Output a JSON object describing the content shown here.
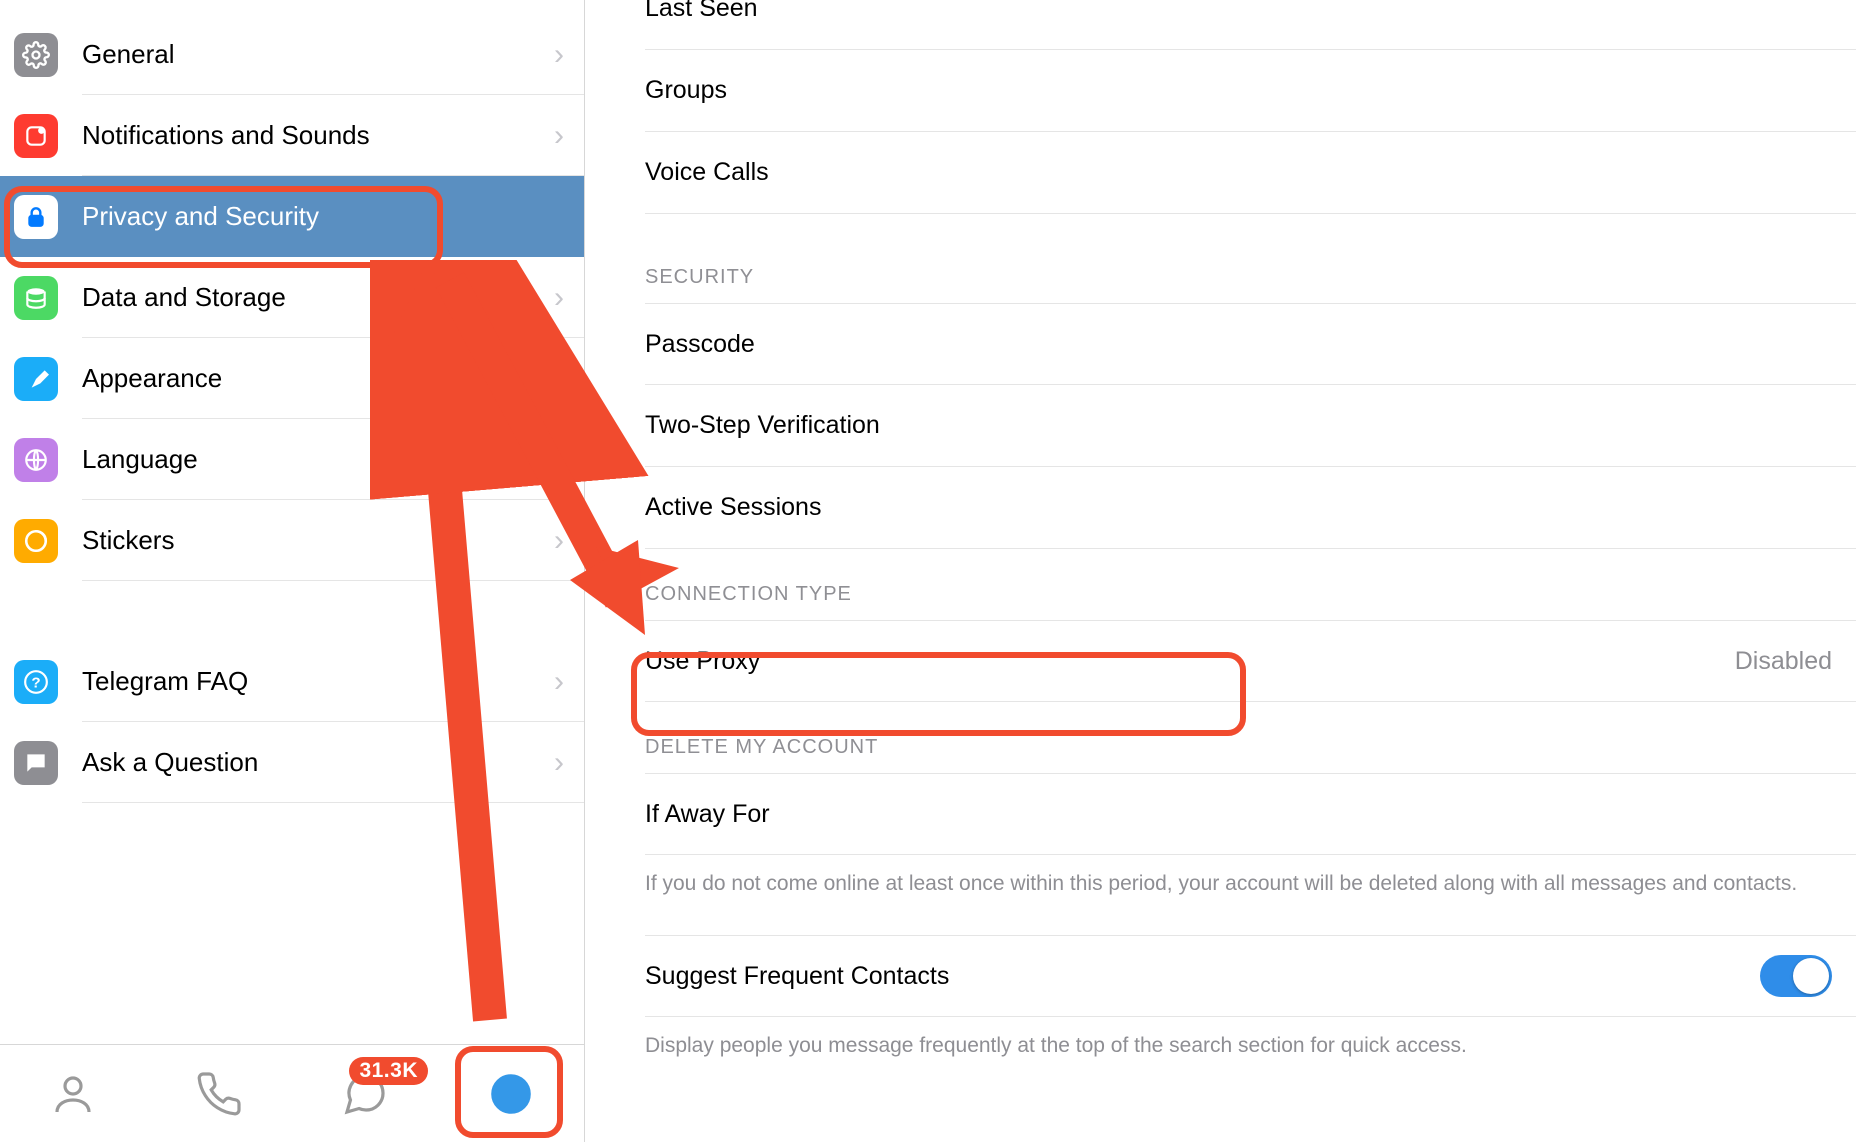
{
  "sidebar": {
    "items": [
      {
        "id": "general",
        "label": "General",
        "icon": "gear",
        "color": "#8e8e93"
      },
      {
        "id": "notif",
        "label": "Notifications and Sounds",
        "icon": "bell",
        "color": "#fe3b30"
      },
      {
        "id": "privacy",
        "label": "Privacy and Security",
        "icon": "lock",
        "color": "#027aff",
        "selected": true
      },
      {
        "id": "data",
        "label": "Data and Storage",
        "icon": "db",
        "color": "#4cd964"
      },
      {
        "id": "appear",
        "label": "Appearance",
        "icon": "brush",
        "color": "#1badf8"
      },
      {
        "id": "lang",
        "label": "Language",
        "icon": "globe",
        "color": "#c080e8"
      },
      {
        "id": "stickers",
        "label": "Stickers",
        "icon": "sticker",
        "color": "#ffab00"
      }
    ],
    "help_items": [
      {
        "id": "faq",
        "label": "Telegram FAQ",
        "icon": "help",
        "color": "#1badf8"
      },
      {
        "id": "ask",
        "label": "Ask a Question",
        "icon": "chat",
        "color": "#8e8e93"
      }
    ]
  },
  "tabbar": {
    "badge": "31.3K"
  },
  "detail": {
    "privacy_rows": [
      {
        "label": "Last Seen"
      },
      {
        "label": "Groups"
      },
      {
        "label": "Voice Calls"
      }
    ],
    "security_header": "SECURITY",
    "security_rows": [
      {
        "label": "Passcode"
      },
      {
        "label": "Two-Step Verification"
      },
      {
        "label": "Active Sessions"
      }
    ],
    "connection_header": "CONNECTION TYPE",
    "connection_row": {
      "label": "Use Proxy",
      "value": "Disabled"
    },
    "delete_header": "DELETE MY ACCOUNT",
    "delete_row": {
      "label": "If Away For"
    },
    "delete_footer": "If you do not come online at least once within this period, your account will be deleted along with all messages and contacts.",
    "suggest_row": {
      "label": "Suggest Frequent Contacts"
    },
    "suggest_footer": "Display people you message frequently at the top of the search section for quick access."
  }
}
